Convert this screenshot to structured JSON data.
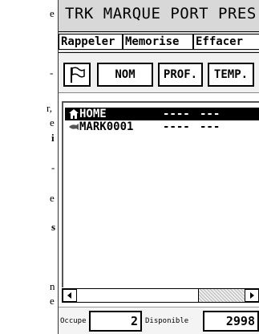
{
  "doc": {
    "fragments": [
      "e",
      "-",
      "r,",
      "e",
      "i",
      "-",
      "e",
      "s",
      "n",
      "e"
    ]
  },
  "app": {
    "title": "TRK  MARQUE PORT PRES"
  },
  "menu": {
    "items": [
      {
        "label": "Rappeler"
      },
      {
        "label": "Memorise"
      },
      {
        "label": "Effacer"
      }
    ]
  },
  "toolbar": {
    "flag_icon": "flag-icon",
    "columns": [
      {
        "label": "NOM"
      },
      {
        "label": "PROF."
      },
      {
        "label": "TEMP."
      }
    ]
  },
  "list": {
    "rows": [
      {
        "icon": "home-icon",
        "name": "HOME",
        "depth": "----",
        "temp": "---",
        "selected": true
      },
      {
        "icon": "fish-icon",
        "name": "MARK0001",
        "depth": "----",
        "temp": "---",
        "selected": false
      }
    ]
  },
  "status": {
    "used_label": "Occupe",
    "used_value": "2",
    "available_label": "Disponible",
    "available_value": "2998"
  }
}
